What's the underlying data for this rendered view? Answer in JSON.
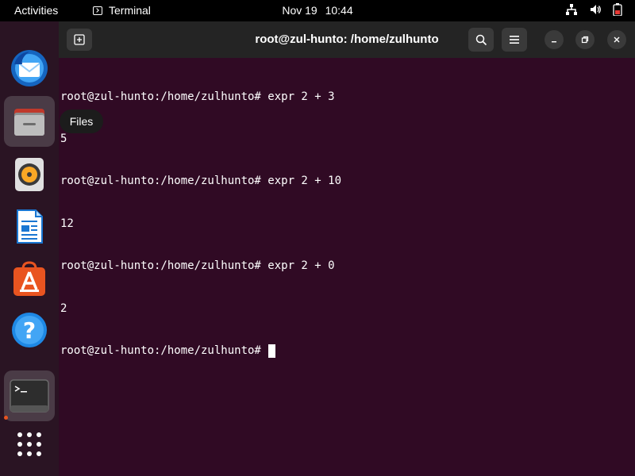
{
  "topbar": {
    "activities_label": "Activities",
    "app_menu_label": "Terminal",
    "date": "Nov 19",
    "time": "10:44",
    "icons": [
      "network-icon",
      "volume-icon",
      "battery-icon"
    ]
  },
  "dock": {
    "items": [
      {
        "name": "thunderbird",
        "icon": "mail-client-icon"
      },
      {
        "name": "files",
        "icon": "file-manager-icon"
      },
      {
        "name": "rhythmbox",
        "icon": "music-player-icon"
      },
      {
        "name": "libreoffice-writer",
        "icon": "document-editor-icon"
      },
      {
        "name": "ubuntu-software",
        "icon": "app-store-icon"
      },
      {
        "name": "help",
        "icon": "help-icon"
      },
      {
        "name": "terminal",
        "icon": "terminal-icon"
      },
      {
        "name": "show-applications",
        "icon": "app-grid-icon"
      }
    ],
    "tooltip": "Files",
    "running_indicator_color": "#e95420"
  },
  "window": {
    "title": "root@zul-hunto: /home/zulhunto",
    "background": "#300a24",
    "header_background": "#242424"
  },
  "terminal": {
    "lines": [
      "root@zul-hunto:/home/zulhunto# expr 2 + 3",
      "5",
      "root@zul-hunto:/home/zulhunto# expr 2 + 10",
      "12",
      "root@zul-hunto:/home/zulhunto# expr 2 + 0",
      "2",
      "root@zul-hunto:/home/zulhunto# "
    ]
  }
}
